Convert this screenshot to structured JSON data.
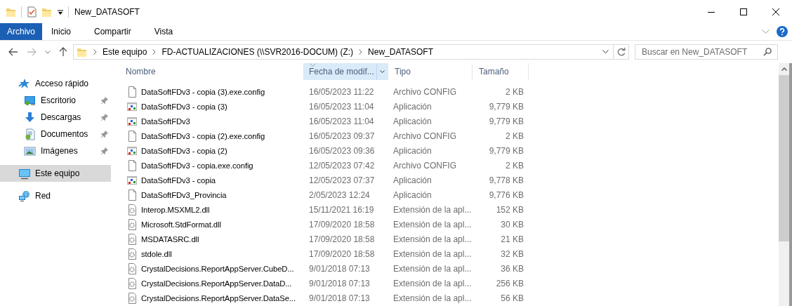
{
  "window": {
    "title": "New_DATASOFT"
  },
  "ribbon": {
    "tabs": [
      {
        "label": "Archivo",
        "kind": "file"
      },
      {
        "label": "Inicio",
        "kind": "tab"
      },
      {
        "label": "Compartir",
        "kind": "tab"
      },
      {
        "label": "Vista",
        "kind": "tab"
      }
    ]
  },
  "address_bar": {
    "path": [
      "Este equipo",
      "FD-ACTUALIZACIONES (\\\\SVR2016-DOCUM) (Z:)",
      "New_DATASOFT"
    ]
  },
  "search": {
    "placeholder": "Buscar en New_DATASOFT"
  },
  "sidebar": {
    "items": [
      {
        "label": "Acceso rápido",
        "kind": "star",
        "selected": false,
        "children": [
          {
            "label": "Escritorio",
            "kind": "desktop",
            "pinned": true,
            "selected": false
          },
          {
            "label": "Descargas",
            "kind": "download",
            "pinned": true,
            "selected": false
          },
          {
            "label": "Documentos",
            "kind": "documents",
            "pinned": true,
            "selected": false
          },
          {
            "label": "Imágenes",
            "kind": "pictures",
            "pinned": true,
            "selected": false
          }
        ]
      },
      {
        "label": "Este equipo",
        "kind": "computer",
        "selected": true
      },
      {
        "label": "Red",
        "kind": "network",
        "selected": false
      }
    ]
  },
  "table": {
    "columns": [
      {
        "label": "Nombre",
        "sorted": false
      },
      {
        "label": "Fecha de modif...",
        "sorted": true
      },
      {
        "label": "Tipo",
        "sorted": false
      },
      {
        "label": "Tamaño",
        "sorted": false
      }
    ],
    "rows": [
      {
        "kind": "config",
        "name": "DataSoftFDv3 - copia (3).exe.config",
        "date": "16/05/2023 11:22",
        "type": "Archivo CONFIG",
        "size": "2 KB"
      },
      {
        "kind": "app",
        "name": "DataSoftFDv3 - copia (3)",
        "date": "16/05/2023 11:04",
        "type": "Aplicación",
        "size": "9,779 KB"
      },
      {
        "kind": "app",
        "name": "DataSoftFDv3",
        "date": "16/05/2023 11:04",
        "type": "Aplicación",
        "size": "9,779 KB"
      },
      {
        "kind": "config",
        "name": "DataSoftFDv3 - copia (2).exe.config",
        "date": "16/05/2023 09:37",
        "type": "Archivo CONFIG",
        "size": "2 KB"
      },
      {
        "kind": "app",
        "name": "DataSoftFDv3 - copia (2)",
        "date": "16/05/2023 09:36",
        "type": "Aplicación",
        "size": "9,779 KB"
      },
      {
        "kind": "config",
        "name": "DataSoftFDv3 - copia.exe.config",
        "date": "12/05/2023 07:42",
        "type": "Archivo CONFIG",
        "size": "2 KB"
      },
      {
        "kind": "app",
        "name": "DataSoftFDv3 - copia",
        "date": "12/05/2023 07:37",
        "type": "Aplicación",
        "size": "9,778 KB"
      },
      {
        "kind": "config",
        "name": "DataSoftFDv3_Provincia",
        "date": "2/05/2023 12:24",
        "type": "Aplicación",
        "size": "9,776 KB"
      },
      {
        "kind": "dll",
        "name": "Interop.MSXML2.dll",
        "date": "15/11/2021 16:19",
        "type": "Extensión de la apl...",
        "size": "152 KB"
      },
      {
        "kind": "dll",
        "name": "Microsoft.StdFormat.dll",
        "date": "17/09/2020 18:58",
        "type": "Extensión de la apl...",
        "size": "30 KB"
      },
      {
        "kind": "dll",
        "name": "MSDATASRC.dll",
        "date": "17/09/2020 18:58",
        "type": "Extensión de la apl...",
        "size": "21 KB"
      },
      {
        "kind": "dll",
        "name": "stdole.dll",
        "date": "17/09/2020 18:58",
        "type": "Extensión de la apl...",
        "size": "32 KB"
      },
      {
        "kind": "dll",
        "name": "CrystalDecisions.ReportAppServer.CubeD...",
        "date": "9/01/2018 07:13",
        "type": "Extensión de la apl...",
        "size": "36 KB"
      },
      {
        "kind": "dll",
        "name": "CrystalDecisions.ReportAppServer.DataD...",
        "date": "9/01/2018 07:13",
        "type": "Extensión de la apl...",
        "size": "256 KB"
      },
      {
        "kind": "dll",
        "name": "CrystalDecisions.ReportAppServer.DataSe...",
        "date": "9/01/2018 07:13",
        "type": "Extensión de la apl...",
        "size": "56 KB"
      }
    ]
  }
}
